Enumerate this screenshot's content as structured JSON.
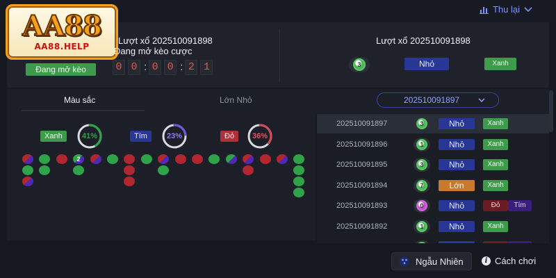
{
  "logo": {
    "main": "AA88",
    "sub": "AA88.HELP"
  },
  "header": {
    "history_label": "Thu lại"
  },
  "current": {
    "draw_title": "Lượt xổ 202510091898",
    "status": "Đang mở kèo cược",
    "badge": "Đang mở kèo",
    "countdown": [
      "0",
      "0",
      "0",
      "0",
      "2",
      "1"
    ]
  },
  "last_result": {
    "draw_title": "Lượt xổ 202510091898",
    "number": "3",
    "size": "Nhỏ",
    "color": "Xanh"
  },
  "tabs": {
    "color": "Màu sắc",
    "size": "Lớn Nhỏ"
  },
  "period_select": {
    "value": "202510091897"
  },
  "stats": {
    "xanh": {
      "label": "Xanh",
      "percent": "41%",
      "value": 41,
      "color": "#2fa34a"
    },
    "tim": {
      "label": "Tím",
      "percent": "23%",
      "value": 23,
      "color": "#6b55d8"
    },
    "do": {
      "label": "Đỏ",
      "percent": "36%",
      "value": 36,
      "color": "#d2495a"
    }
  },
  "history": [
    {
      "period": "202510091897",
      "number": "3",
      "ball": "green",
      "size": "Nhỏ",
      "size_type": "small",
      "color1": "Xanh",
      "c1": "green"
    },
    {
      "period": "202510091896",
      "number": "1",
      "ball": "green",
      "size": "Nhỏ",
      "size_type": "small",
      "color1": "Xanh",
      "c1": "green"
    },
    {
      "period": "202510091895",
      "number": "3",
      "ball": "green",
      "size": "Nhỏ",
      "size_type": "small",
      "color1": "Xanh",
      "c1": "green"
    },
    {
      "period": "202510091894",
      "number": "7",
      "ball": "green",
      "size": "Lớn",
      "size_type": "big",
      "color1": "Xanh",
      "c1": "green"
    },
    {
      "period": "202510091893",
      "number": "0",
      "ball": "purple",
      "size": "Nhỏ",
      "size_type": "small",
      "color1": "Đỏ",
      "c1": "red",
      "color2": "Tím",
      "c2": "purple"
    },
    {
      "period": "202510091892",
      "number": "1",
      "ball": "green",
      "size": "Nhỏ",
      "size_type": "small",
      "color1": "Xanh",
      "c1": "green"
    }
  ],
  "buttons": {
    "random": "Ngẫu Nhiên",
    "rules": "Cách chơi",
    "rules_icon": "i"
  },
  "board": {
    "columns": [
      [
        "rp",
        "g",
        "rp"
      ],
      [
        "g",
        "g"
      ],
      [
        "r"
      ],
      [
        "gp",
        "g"
      ],
      [
        "rp"
      ],
      [
        "g"
      ],
      [
        "r",
        "r",
        "r"
      ],
      [
        "g"
      ],
      [
        "rp",
        "g"
      ],
      [
        "r"
      ],
      [
        "r"
      ],
      [
        "g"
      ],
      [
        "gp"
      ],
      [
        "rp",
        "r"
      ],
      [
        "r"
      ],
      [
        "rp"
      ],
      [
        "g",
        "g",
        "g",
        "g"
      ]
    ],
    "marked_number": "2"
  }
}
